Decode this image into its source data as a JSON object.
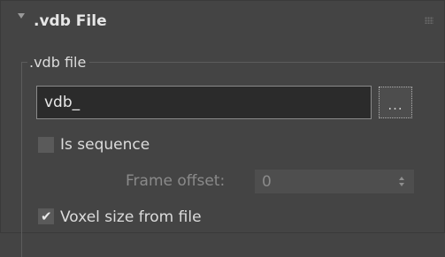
{
  "rollout": {
    "title": ".vdb File",
    "collapse_icon": "triangle-down",
    "grip_icon": "drag-grip"
  },
  "group": {
    "title": ".vdb file"
  },
  "file": {
    "value": "vdb_",
    "browse_label": "..."
  },
  "is_sequence": {
    "label": "Is sequence",
    "checked": false
  },
  "frame_offset": {
    "label": "Frame offset:",
    "value": "0",
    "enabled": false
  },
  "voxel_size": {
    "label": "Voxel size from file",
    "checked": true,
    "check_glyph": "✔"
  },
  "colors": {
    "panel_bg": "#444444",
    "input_bg": "#2b2b2b",
    "text": "#dcdcdc",
    "disabled_text": "#8a8a8a"
  }
}
